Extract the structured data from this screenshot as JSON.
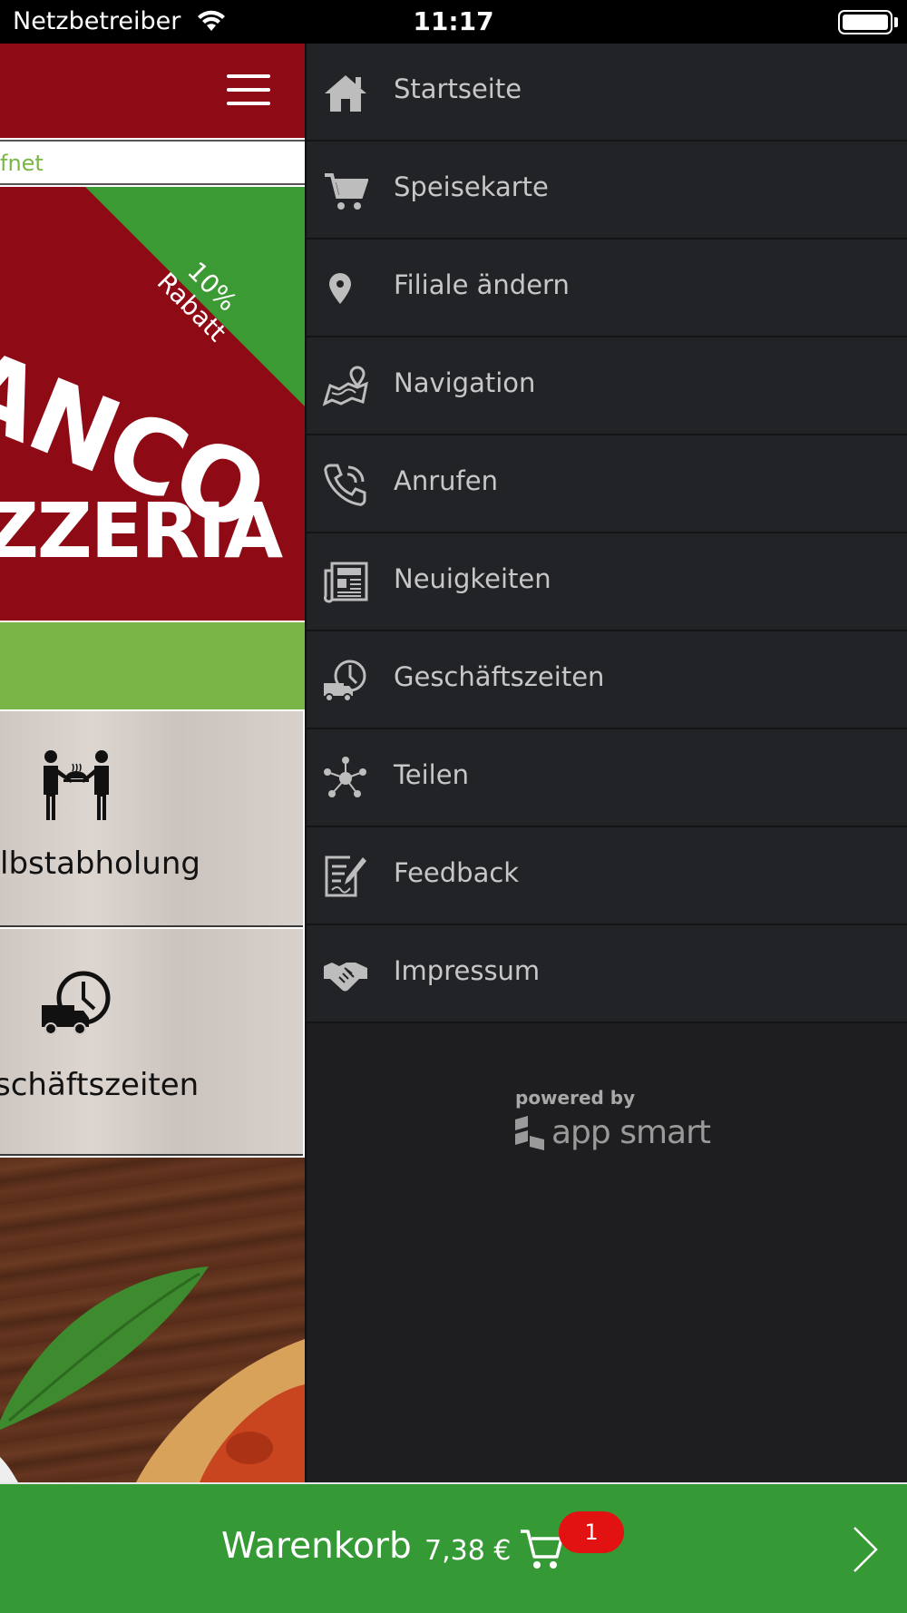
{
  "status_bar": {
    "carrier": "Netzbetreiber",
    "time": "11:17",
    "wifi_icon": "wifi-icon",
    "battery_icon": "battery-icon"
  },
  "app": {
    "status_text": "fnet",
    "banner": {
      "badge_line1": "10%",
      "badge_line2": "Rabatt",
      "logo_top": "ANCO",
      "logo_bottom": "ZZERIA",
      "badge_color": "#3c9a34",
      "brand_color": "#8e0a15"
    },
    "tiles": [
      {
        "label": "lbstabholung",
        "icon": "pickup-icon"
      },
      {
        "label": "schäftszeiten",
        "icon": "delivery-clock-icon"
      }
    ],
    "menu_icon": "hamburger-icon"
  },
  "drawer": {
    "items": [
      {
        "label": "Startseite",
        "icon": "home-icon"
      },
      {
        "label": "Speisekarte",
        "icon": "cart-icon"
      },
      {
        "label": "Filiale ändern",
        "icon": "map-pin-icon"
      },
      {
        "label": "Navigation",
        "icon": "map-icon"
      },
      {
        "label": "Anrufen",
        "icon": "phone-icon"
      },
      {
        "label": "Neuigkeiten",
        "icon": "newspaper-icon"
      },
      {
        "label": "Geschäftszeiten",
        "icon": "delivery-clock-icon"
      },
      {
        "label": "Teilen",
        "icon": "share-icon"
      },
      {
        "label": "Feedback",
        "icon": "feedback-icon"
      },
      {
        "label": "Impressum",
        "icon": "handshake-icon"
      }
    ],
    "powered_by": "powered by",
    "brand": "app smart"
  },
  "cart": {
    "label": "Warenkorb",
    "price": "7,38 €",
    "count": "1",
    "bar_color": "#359a35",
    "badge_color": "#e31212"
  }
}
